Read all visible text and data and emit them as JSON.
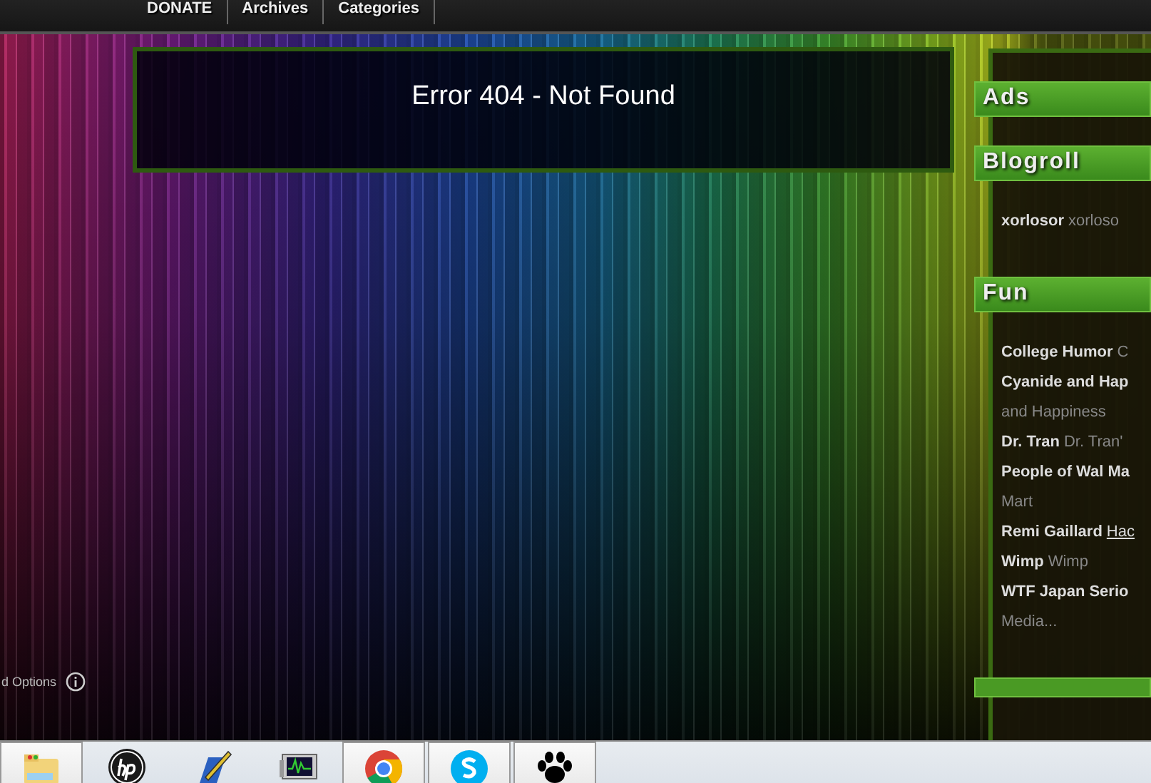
{
  "nav": {
    "items": [
      {
        "label": "DONATE"
      },
      {
        "label": "Archives"
      },
      {
        "label": "Categories"
      }
    ]
  },
  "error": {
    "title": "Error 404 - Not Found"
  },
  "options": {
    "label": "d Options"
  },
  "sidebar": {
    "sections": [
      {
        "title": "Ads"
      },
      {
        "title": "Blogroll",
        "links": [
          {
            "name": "xorlosor",
            "note": "xorloso",
            "kind": "inline",
            "underlined": false
          }
        ]
      },
      {
        "title": "Fun",
        "links": [
          {
            "name": "College Humor",
            "note": "C",
            "kind": "inline",
            "underlined": false
          },
          {
            "name": "Cyanide and Hap",
            "note": "and Happiness",
            "kind": "wrapped",
            "underlined": false
          },
          {
            "name": "Dr. Tran",
            "note": "Dr. Tran'",
            "kind": "inline",
            "underlined": false
          },
          {
            "name": "People of Wal Ma",
            "note": "Mart",
            "kind": "wrapped",
            "underlined": false
          },
          {
            "name": "Remi Gaillard",
            "note": "Hac",
            "kind": "inline",
            "underlined": true
          },
          {
            "name": "Wimp",
            "note": "Wimp",
            "kind": "inline",
            "underlined": false
          },
          {
            "name": "WTF Japan Serio",
            "note": "Media...",
            "kind": "wrapped",
            "underlined": false
          }
        ]
      }
    ]
  },
  "taskbar": {
    "items": [
      {
        "open": true
      },
      {
        "open": false
      },
      {
        "open": false
      },
      {
        "open": false
      },
      {
        "open": true
      },
      {
        "open": true
      },
      {
        "open": true
      }
    ]
  }
}
